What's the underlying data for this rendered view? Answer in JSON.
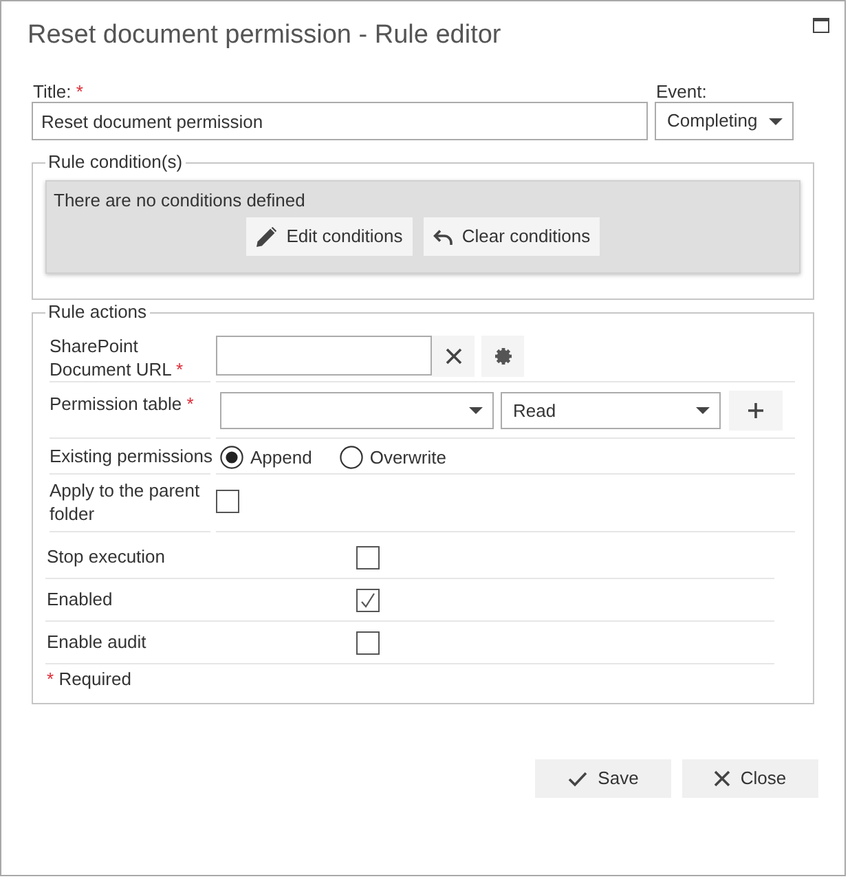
{
  "window": {
    "title": "Reset document permission - Rule editor"
  },
  "title_field": {
    "label": "Title:",
    "required_mark": "*",
    "value": "Reset document permission"
  },
  "event_field": {
    "label": "Event:",
    "value": "Completing"
  },
  "rule_conditions": {
    "legend": "Rule condition(s)",
    "message": "There are no conditions defined",
    "edit_button": {
      "label": "Edit conditions"
    },
    "clear_button": {
      "label": "Clear conditions"
    }
  },
  "rule_actions": {
    "legend": "Rule actions",
    "document_url": {
      "label": "SharePoint Document URL",
      "required_mark": "*"
    },
    "permission_table": {
      "label": "Permission table",
      "required_mark": "*",
      "permission_select": {
        "value": "Read"
      }
    },
    "existing_permissions": {
      "label": "Existing permissions",
      "options": [
        {
          "label": "Append",
          "selected": true
        },
        {
          "label": "Overwrite",
          "selected": false
        }
      ]
    },
    "apply_to_parent_folder": {
      "label": "Apply to the parent folder",
      "checked": false
    },
    "options": [
      {
        "label": "Stop execution",
        "checked": false
      },
      {
        "label": "Enabled",
        "checked": true
      },
      {
        "label": "Enable audit",
        "checked": false
      }
    ],
    "required_note": {
      "mark": "*",
      "text": "Required"
    }
  },
  "buttons": {
    "save": {
      "label": "Save"
    },
    "close": {
      "label": "Close"
    }
  }
}
